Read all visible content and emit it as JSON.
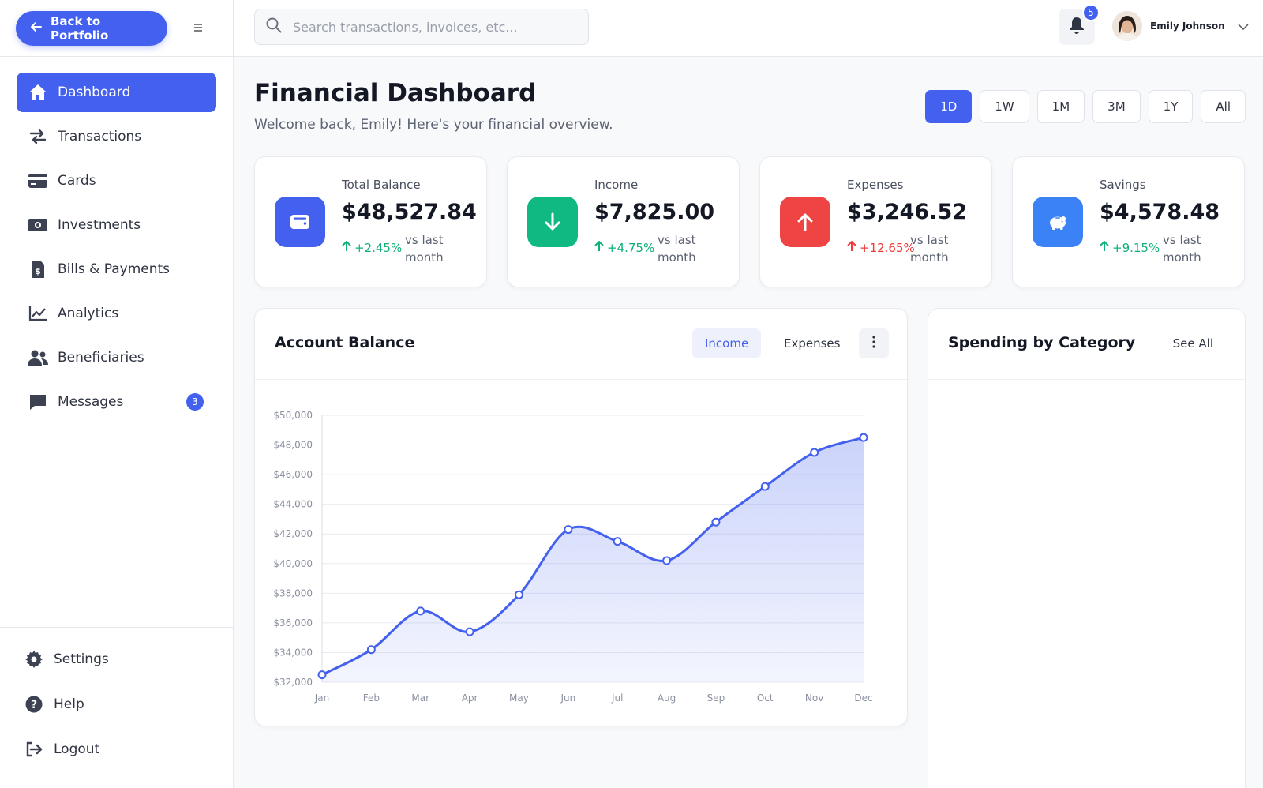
{
  "sidebar": {
    "back_label": "Back to Portfolio",
    "items": [
      {
        "label": "Dashboard",
        "icon": "home-icon",
        "active": true
      },
      {
        "label": "Transactions",
        "icon": "exchange-icon"
      },
      {
        "label": "Cards",
        "icon": "credit-card-icon"
      },
      {
        "label": "Investments",
        "icon": "money-icon"
      },
      {
        "label": "Bills & Payments",
        "icon": "invoice-icon"
      },
      {
        "label": "Analytics",
        "icon": "line-chart-icon"
      },
      {
        "label": "Beneficiaries",
        "icon": "users-icon"
      },
      {
        "label": "Messages",
        "icon": "message-icon",
        "badge": "3"
      }
    ],
    "bottom": [
      {
        "label": "Settings",
        "icon": "gear-icon"
      },
      {
        "label": "Help",
        "icon": "help-icon"
      },
      {
        "label": "Logout",
        "icon": "logout-icon"
      }
    ]
  },
  "header": {
    "search_placeholder": "Search transactions, invoices, etc...",
    "notifications_count": "5",
    "user_name": "Emily Johnson"
  },
  "page": {
    "title": "Financial Dashboard",
    "subtitle": "Welcome back, Emily! Here's your financial overview.",
    "ranges": [
      "1D",
      "1W",
      "1M",
      "3M",
      "1Y",
      "All"
    ],
    "active_range": "1D"
  },
  "stats": [
    {
      "label": "Total Balance",
      "value": "$48,527.84",
      "change": "+2.45%",
      "trend": "up",
      "compare": "vs last month",
      "icon": "wallet-icon",
      "color": "#4361ee"
    },
    {
      "label": "Income",
      "value": "$7,825.00",
      "change": "+4.75%",
      "trend": "up",
      "compare": "vs last month",
      "icon": "arrow-down-icon",
      "color": "#10b981"
    },
    {
      "label": "Expenses",
      "value": "$3,246.52",
      "change": "+12.65%",
      "trend": "down",
      "compare": "vs last month",
      "icon": "arrow-up-icon",
      "color": "#ef4444"
    },
    {
      "label": "Savings",
      "value": "$4,578.48",
      "change": "+9.15%",
      "trend": "up",
      "compare": "vs last month",
      "icon": "piggy-bank-icon",
      "color": "#3b82f6"
    }
  ],
  "account_balance": {
    "title": "Account Balance",
    "tabs": [
      "Income",
      "Expenses"
    ],
    "active_tab": "Income"
  },
  "spending": {
    "title": "Spending by Category",
    "see_all": "See All"
  },
  "colors": {
    "accent": "#4361ee",
    "positive": "#10b076",
    "negative": "#ef3a3a"
  },
  "chart_data": {
    "type": "area",
    "categories": [
      "Jan",
      "Feb",
      "Mar",
      "Apr",
      "May",
      "Jun",
      "Jul",
      "Aug",
      "Sep",
      "Oct",
      "Nov",
      "Dec"
    ],
    "series": [
      {
        "values": [
          32500,
          34200,
          36800,
          35400,
          37900,
          42300,
          41500,
          40200,
          42800,
          45200,
          47500,
          48500
        ]
      }
    ],
    "yticks": [
      "$32,000",
      "$34,000",
      "$36,000",
      "$38,000",
      "$40,000",
      "$42,000",
      "$44,000",
      "$46,000",
      "$48,000",
      "$50,000"
    ],
    "ylim": [
      32000,
      50000
    ],
    "grid": true,
    "xlabel": "",
    "ylabel": "",
    "title": ""
  }
}
